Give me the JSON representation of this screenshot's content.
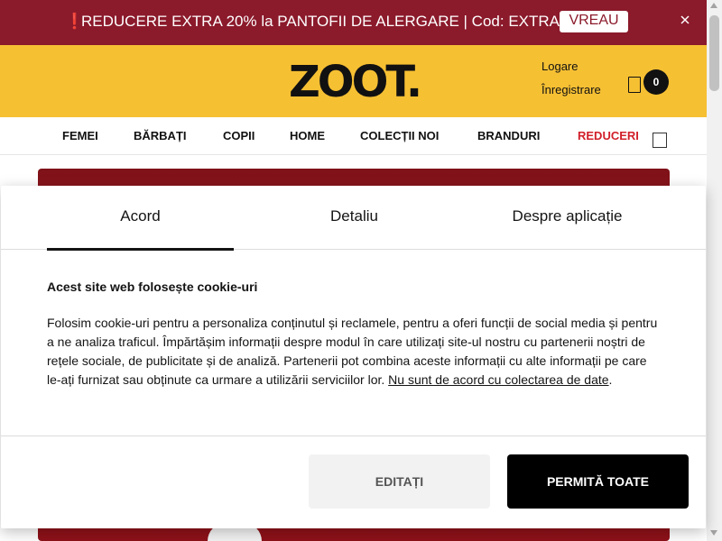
{
  "promo": {
    "icon": "exclamation-icon",
    "text": "REDUCERE EXTRA 20% la PANTOFII DE ALERGARE | Cod: EXTRA20",
    "cta_label": "VREAU",
    "close_icon": "close-icon",
    "bg_color": "#8b1a2b"
  },
  "header": {
    "logo_text": "ZOOT.",
    "login_label": "Logare",
    "register_label": "Înregistrare",
    "cart_icon": "shopping-bag-icon",
    "cart_count": "0",
    "bg_color": "#f6c033"
  },
  "nav": {
    "items": [
      {
        "label": "FEMEI"
      },
      {
        "label": "BĂRBAȚI"
      },
      {
        "label": "COPII"
      },
      {
        "label": "HOME"
      },
      {
        "label": "COLECȚII NOI"
      },
      {
        "label": "BRANDURI"
      },
      {
        "label": "REDUCERI"
      }
    ],
    "search_icon": "search-icon",
    "accent_color": "#d11f2a"
  },
  "cookie": {
    "tabs": [
      {
        "label": "Acord",
        "active": true
      },
      {
        "label": "Detaliu",
        "active": false
      },
      {
        "label": "Despre aplicație",
        "active": false
      }
    ],
    "heading": "Acest site web folosește cookie-uri",
    "body": "Folosim cookie-uri pentru a personaliza conținutul și reclamele, pentru a oferi funcții de social media și pentru a ne analiza traficul. Împărtășim informații despre modul în care utilizați site-ul nostru cu partenerii noștri de rețele sociale, de publicitate și de analiză. Partenerii pot combina aceste informații cu alte informații pe care le-ați furnizat sau obținute ca urmare a utilizării serviciilor lor.",
    "decline_link": "Nu sunt de acord cu colectarea de date",
    "edit_label": "EDITAȚI",
    "allow_label": "PERMITĂ TOATE"
  }
}
